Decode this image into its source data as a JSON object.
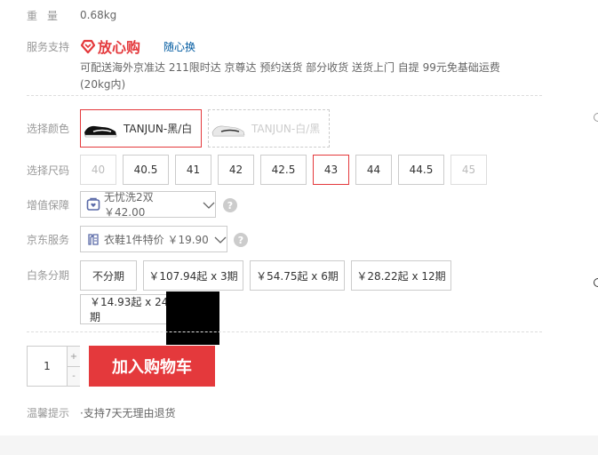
{
  "weight": {
    "label": "重量",
    "value": "0.68kg"
  },
  "service": {
    "label": "服务支持",
    "brand": "放心购",
    "link": "随心换",
    "items_line1": "可配送海外京准达 211限时达 京尊达 预约送货 部分收货 送货上门 自提 99元免基础运费",
    "items_line2": "(20kg内)"
  },
  "color": {
    "label": "选择颜色",
    "options": [
      {
        "label": "TANJUN-黑/白",
        "selected": true,
        "disabled": false
      },
      {
        "label": "TANJUN-白/黑",
        "selected": false,
        "disabled": true
      }
    ]
  },
  "size": {
    "label": "选择尺码",
    "options": [
      {
        "label": "40",
        "selected": false,
        "disabled": true
      },
      {
        "label": "40.5",
        "selected": false,
        "disabled": false
      },
      {
        "label": "41",
        "selected": false,
        "disabled": false
      },
      {
        "label": "42",
        "selected": false,
        "disabled": false
      },
      {
        "label": "42.5",
        "selected": false,
        "disabled": false
      },
      {
        "label": "43",
        "selected": true,
        "disabled": false
      },
      {
        "label": "44",
        "selected": false,
        "disabled": false
      },
      {
        "label": "44.5",
        "selected": false,
        "disabled": false
      },
      {
        "label": "45",
        "selected": false,
        "disabled": true
      }
    ]
  },
  "warranty": {
    "label": "增值保障",
    "value": "无忧洗2双 ￥42.00",
    "help": "?"
  },
  "jd_service": {
    "label": "京东服务",
    "value": "衣鞋1件特价 ￥19.90",
    "help": "?"
  },
  "installment": {
    "label": "白条分期",
    "options": [
      {
        "label": "不分期"
      },
      {
        "label": "￥107.94起 x 3期"
      },
      {
        "label": "￥54.75起 x 6期"
      },
      {
        "label": "￥28.22起 x 12期"
      },
      {
        "label": "￥14.93起 x 24期"
      }
    ]
  },
  "quantity": {
    "value": "1",
    "plus": "+",
    "minus": "-"
  },
  "cart_button": "加入购物车",
  "tip": {
    "label": "温馨提示",
    "value": "·支持7天无理由退货"
  },
  "colors": {
    "accent": "#e4393c",
    "border": "#cccccc",
    "label": "#999999"
  },
  "icons": {
    "heart_brand": "heart-diamond-icon",
    "shield": "shield-icon",
    "service": "service-icon",
    "chevron": "chevron-down-icon"
  }
}
